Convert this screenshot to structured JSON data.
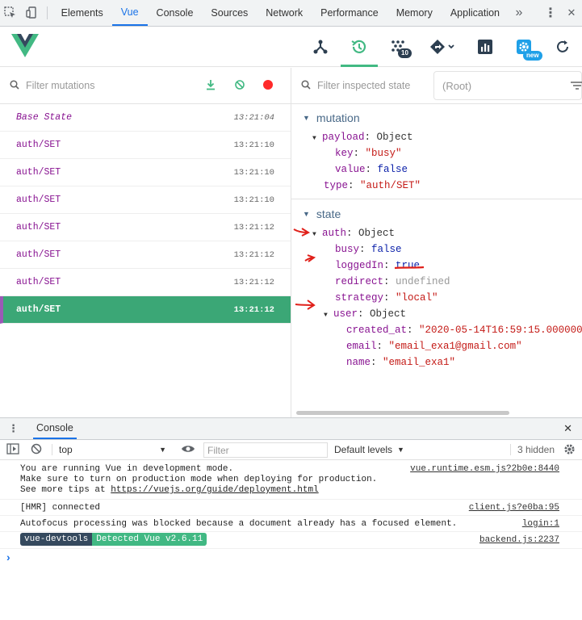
{
  "devtools_tabs": {
    "items": [
      "Elements",
      "Vue",
      "Console",
      "Sources",
      "Network",
      "Performance",
      "Memory",
      "Application"
    ],
    "active": "Vue",
    "more": "»",
    "menu": "⋮",
    "close": "✕"
  },
  "vue_header": {
    "icons": [
      "components-icon",
      "vuex-history-icon",
      "events-icon",
      "routing-icon",
      "performance-icon",
      "settings-icon",
      "refresh-icon"
    ],
    "events_badge": "10",
    "settings_badge": "new",
    "active_icon": "vuex-history-icon",
    "colors": {
      "vue_green": "#42b983",
      "vue_dark": "#35495e"
    }
  },
  "mutations": {
    "filter_placeholder": "Filter mutations",
    "list": [
      {
        "name": "Base State",
        "time": "13:21:04",
        "base": true
      },
      {
        "name": "auth/SET",
        "time": "13:21:10"
      },
      {
        "name": "auth/SET",
        "time": "13:21:10"
      },
      {
        "name": "auth/SET",
        "time": "13:21:10"
      },
      {
        "name": "auth/SET",
        "time": "13:21:12"
      },
      {
        "name": "auth/SET",
        "time": "13:21:12"
      },
      {
        "name": "auth/SET",
        "time": "13:21:12"
      },
      {
        "name": "auth/SET",
        "time": "13:21:12",
        "active": true
      }
    ]
  },
  "inspector": {
    "filter_placeholder": "Filter inspected state",
    "root_select": "(Root)",
    "mutation_title": "mutation",
    "payload_key": "payload",
    "payload_val": "Object",
    "key_key": "key",
    "key_val": "\"busy\"",
    "value_key": "value",
    "value_val": "false",
    "type_key": "type",
    "type_val": "\"auth/SET\"",
    "state_title": "state",
    "auth_key": "auth",
    "auth_val": "Object",
    "busy_key": "busy",
    "busy_val": "false",
    "loggedin_key": "loggedIn",
    "loggedin_val": "true",
    "redirect_key": "redirect",
    "redirect_val": "undefined",
    "strategy_key": "strategy",
    "strategy_val": "\"local\"",
    "user_key": "user",
    "user_val": "Object",
    "created_key": "created_at",
    "created_val": "\"2020-05-14T16:59:15.000000",
    "email_key": "email",
    "email_val": "\"email_exa1@gmail.com\"",
    "name_key": "name",
    "name_val": "\"email_exa1\"",
    "colon": ":"
  },
  "console": {
    "tab": "Console",
    "context": "top",
    "filter_placeholder": "Filter",
    "levels": "Default levels",
    "hidden": "3 hidden",
    "messages": {
      "m1": "You are running Vue in development mode.\nMake sure to turn on production mode when deploying for production.\nSee more tips at ",
      "m1_link": "https://vuejs.org/guide/deployment.html",
      "m1_src": "vue.runtime.esm.js?2b0e:8440",
      "m2": "[HMR] connected",
      "m2_src": "client.js?e0ba:95",
      "m3": "Autofocus processing was blocked because a document already has a focused element.",
      "m3_src": "login:1",
      "m4_pill1": "vue-devtools",
      "m4_pill2": "Detected Vue v2.6.11",
      "m4_src": "backend.js:2237"
    },
    "prompt": "›"
  }
}
